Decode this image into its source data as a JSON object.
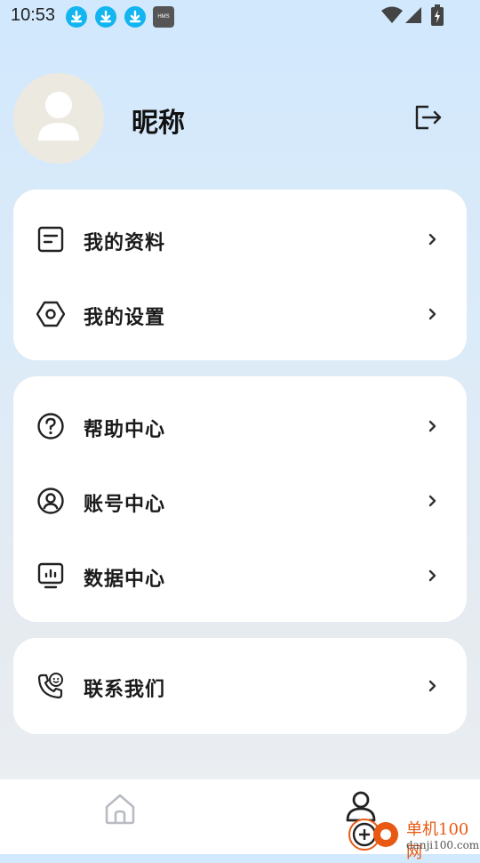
{
  "status_bar": {
    "time": "10:53",
    "notification_icons": [
      "download-icon",
      "download-icon",
      "download-icon",
      "hms-icon"
    ],
    "hms_text": "HMS",
    "system_icons": [
      "wifi-icon",
      "signal-icon",
      "battery-charging-icon"
    ]
  },
  "profile": {
    "nickname": "昵称",
    "avatar_icon": "default-avatar-icon",
    "logout_icon": "logout-icon"
  },
  "menu_groups": [
    {
      "items": [
        {
          "label": "我的资料",
          "icon": "profile-card-icon"
        },
        {
          "label": "我的设置",
          "icon": "settings-hexagon-icon"
        }
      ]
    },
    {
      "items": [
        {
          "label": "帮助中心",
          "icon": "help-circle-icon"
        },
        {
          "label": "账号中心",
          "icon": "account-circle-icon"
        },
        {
          "label": "数据中心",
          "icon": "data-monitor-icon"
        }
      ]
    },
    {
      "items": [
        {
          "label": "联系我们",
          "icon": "contact-phone-icon"
        }
      ]
    }
  ],
  "bottom_nav": {
    "items": [
      {
        "icon": "home-icon",
        "active": false
      },
      {
        "icon": "profile-icon",
        "active": true
      }
    ]
  },
  "watermark": {
    "title": "单机100网",
    "url": "danji100.com"
  },
  "colors": {
    "accent": "#12b5f0",
    "watermark": "#e85a14",
    "card": "#ffffff"
  }
}
